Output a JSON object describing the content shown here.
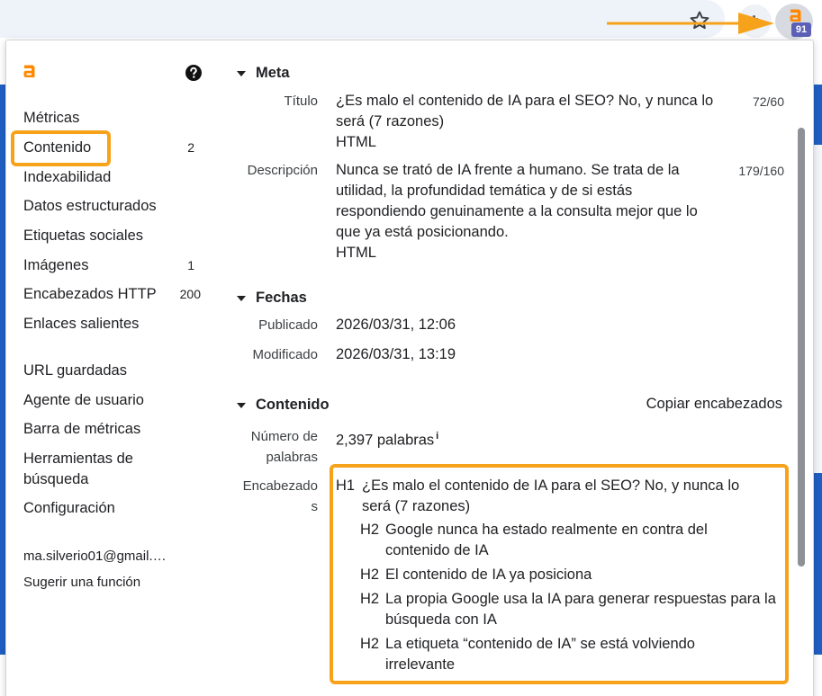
{
  "extension": {
    "badge_count": "91"
  },
  "sidebar": {
    "items": [
      {
        "label": "Métricas",
        "count": ""
      },
      {
        "label": "Contenido",
        "count": "2"
      },
      {
        "label": "Indexabilidad",
        "count": ""
      },
      {
        "label": "Datos estructurados",
        "count": ""
      },
      {
        "label": "Etiquetas sociales",
        "count": ""
      },
      {
        "label": "Imágenes",
        "count": "1"
      },
      {
        "label": "Encabezados HTTP",
        "count": "200"
      },
      {
        "label": "Enlaces salientes",
        "count": ""
      },
      {
        "label": "URL guardadas",
        "count": ""
      },
      {
        "label": "Agente de usuario",
        "count": ""
      },
      {
        "label": "Barra de métricas",
        "count": ""
      },
      {
        "label": "Herramientas de búsqueda",
        "count": ""
      },
      {
        "label": "Configuración",
        "count": ""
      }
    ],
    "account_email": "ma.silverio01@gmail.…",
    "suggest_feature": "Sugerir una función"
  },
  "meta": {
    "section_title": "Meta",
    "title_label": "Título",
    "title_value": "¿Es malo el contenido de IA para el SEO? No, y nunca lo será (7 razones)",
    "title_type": "HTML",
    "title_count": "72/60",
    "description_label": "Descripción",
    "description_value": "Nunca se trató de IA frente a humano. Se trata de la utilidad, la profundidad temática y de si estás respondiendo genuinamente a la consulta mejor que lo que ya está posicionando.",
    "description_type": "HTML",
    "description_count": "179/160"
  },
  "dates": {
    "section_title": "Fechas",
    "published_label": "Publicado",
    "published_value": "2026/03/31, 12:06",
    "modified_label": "Modificado",
    "modified_value": "2026/03/31, 13:19"
  },
  "content": {
    "section_title": "Contenido",
    "copy_headings": "Copiar encabezados",
    "word_count_label": "Número de palabras",
    "word_count_value": "2,397 palabras",
    "info_mark": "i",
    "headings_label": "Encabezados",
    "headings": [
      {
        "level": "H1",
        "text": "¿Es malo el contenido de IA para el SEO? No, y nunca lo será (7 razones)"
      },
      {
        "level": "H2",
        "text": "Google nunca ha estado realmente en contra del contenido de IA"
      },
      {
        "level": "H2",
        "text": "El contenido de IA ya posiciona"
      },
      {
        "level": "H2",
        "text": "La propia Google usa la IA para generar respuestas para la búsqueda con IA"
      },
      {
        "level": "H2",
        "text": "La etiqueta “contenido de IA” se está volviendo irrelevante"
      }
    ]
  },
  "colors": {
    "accent": "#f7a21b",
    "brand": "#ff8800",
    "badge": "#5b5fb5"
  }
}
